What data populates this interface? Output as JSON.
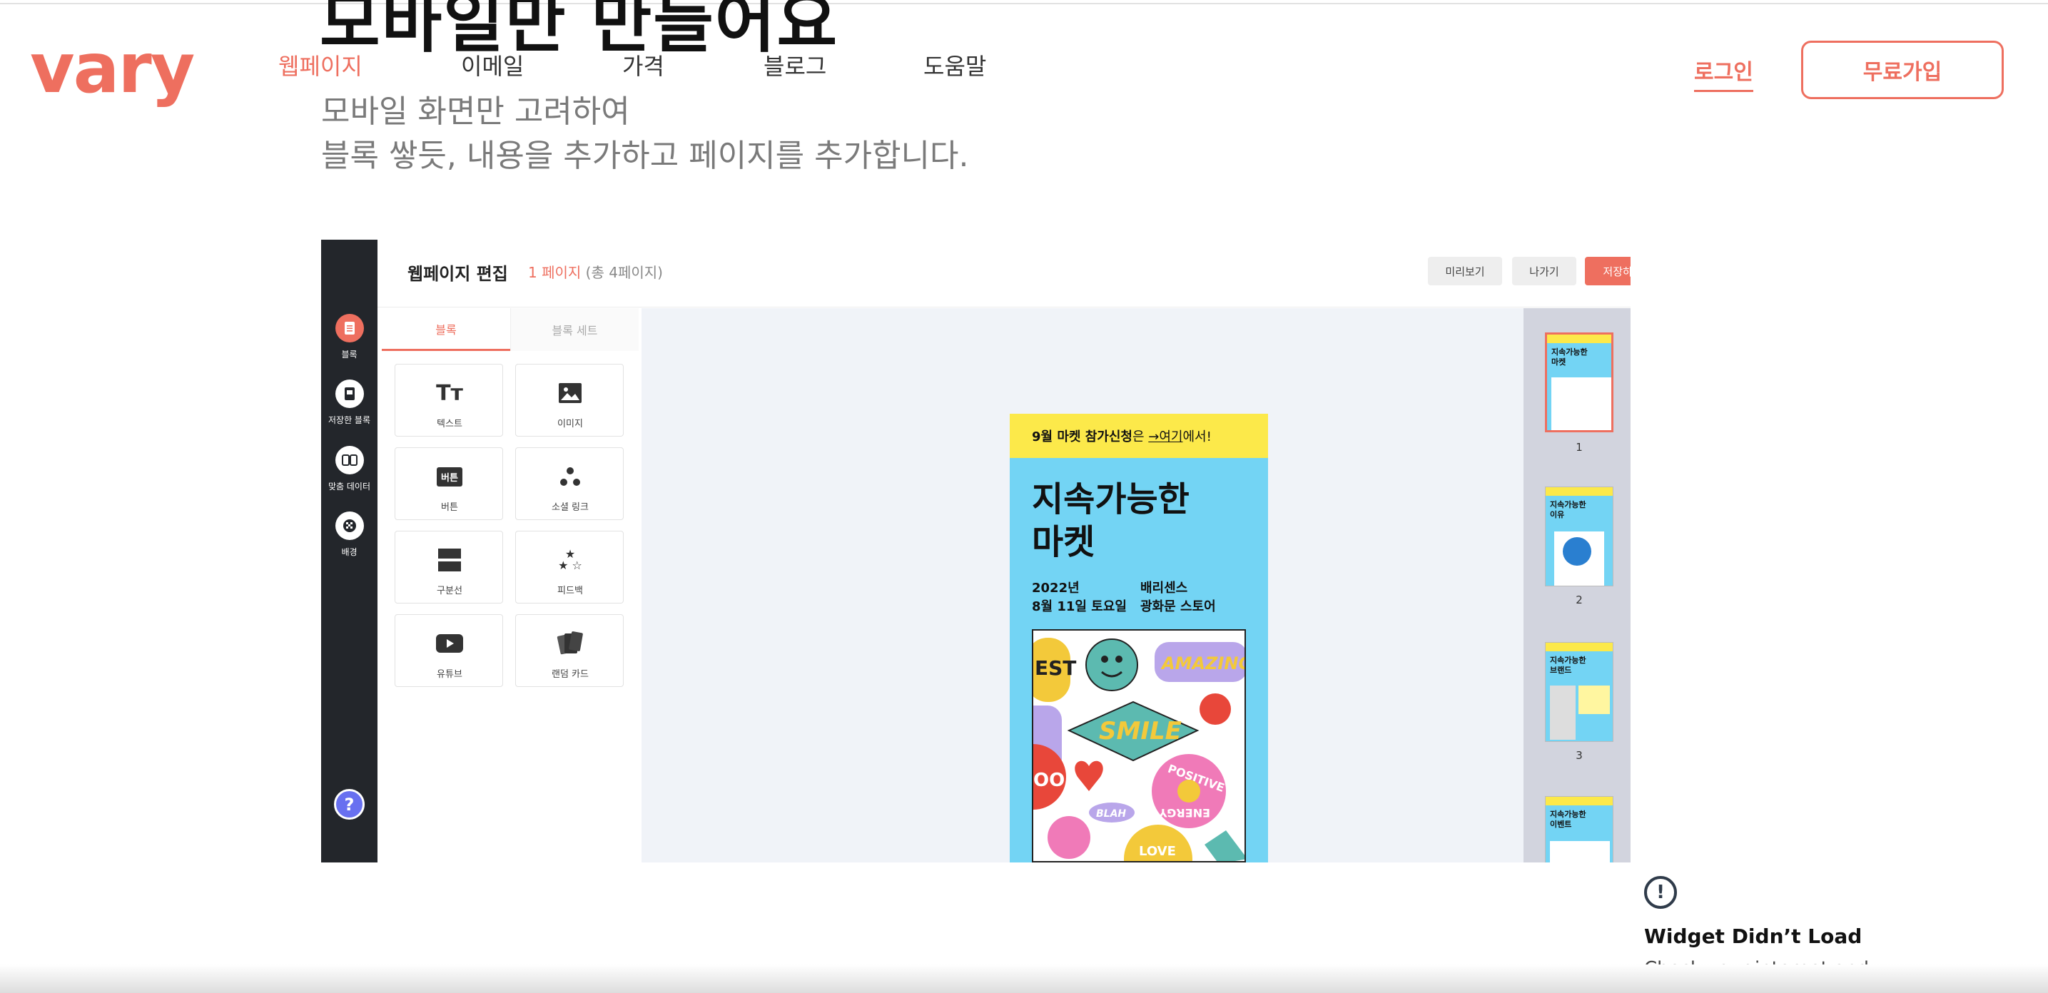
{
  "hero": {
    "title": "모바일만 만들어요",
    "desc_line1": "모바일 화면만 고려하여",
    "desc_line2": "블록 쌓듯, 내용을 추가하고 페이지를 추가합니다."
  },
  "header": {
    "logo": "vary",
    "nav": [
      {
        "label": "웹페이지",
        "active": true
      },
      {
        "label": "이메일"
      },
      {
        "label": "가격"
      },
      {
        "label": "블로그"
      },
      {
        "label": "도움말"
      }
    ],
    "login": "로그인",
    "signup": "무료가입"
  },
  "editor": {
    "title": "웹페이지 편집",
    "page": "1 페이지",
    "total": "(총 4페이지)",
    "undo": "↶",
    "redo": "↷",
    "preview": "미리보기",
    "exit": "나가기",
    "save": "저장하기",
    "sidebar": [
      {
        "label": "블록",
        "icon": "document-icon"
      },
      {
        "label": "저장한 블록",
        "icon": "saved-block-icon"
      },
      {
        "label": "맞춤 데이터",
        "icon": "custom-data-icon"
      },
      {
        "label": "배경",
        "icon": "background-icon"
      }
    ],
    "help": "?",
    "tabs": [
      "블록",
      "블록 세트"
    ],
    "blocks": [
      {
        "label": "텍스트",
        "icon": "Tт"
      },
      {
        "label": "이미지"
      },
      {
        "label": "버튼",
        "icon": "버튼"
      },
      {
        "label": "소셜 링크"
      },
      {
        "label": "구분선"
      },
      {
        "label": "피드백"
      },
      {
        "label": "유튜브"
      },
      {
        "label": "랜덤 카드"
      }
    ],
    "preview_page": {
      "banner_strong": "9월 마켓 참가신청",
      "banner_mid": "은 ",
      "banner_link": "→여기",
      "banner_end": "에서!",
      "title_line1": "지속가능한",
      "title_line2": "마켓",
      "date_line1": "2022년",
      "date_line2": "8월 11일 토요일",
      "place_line1": "배리센스",
      "place_line2": "광화문 스토어",
      "stickers": {
        "est": "EST",
        "amazing": "AMAZING",
        "smile": "SMILE",
        "oom": "OOM",
        "positive": "POSITIVE",
        "energy": "ENERGY",
        "blah": "BLAH",
        "love": "LOVE"
      }
    },
    "thumbnails": [
      {
        "num": "1",
        "title": "지속가능한\n마켓"
      },
      {
        "num": "2",
        "title": "지속가능한\n이유"
      },
      {
        "num": "3",
        "title": "지속가능한\n브랜드"
      },
      {
        "num": "",
        "title": "지속가능한\n이벤트"
      }
    ]
  },
  "widget": {
    "title": "Widget Didn’t Load",
    "text": "Check your internet and refresh this page."
  },
  "colors": {
    "brand": "#ee6f5f",
    "sidebar": "#23262b",
    "phone_bg": "#73d4f4",
    "banner": "#fce94a"
  }
}
